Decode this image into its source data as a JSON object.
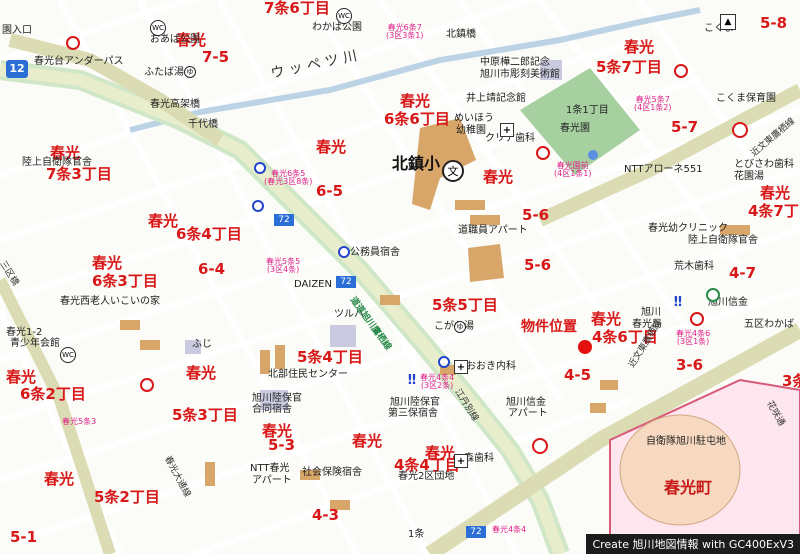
{
  "map": {
    "credit": "Create 旭川地図情報 with GC400ExV3",
    "property_label": "物件位置",
    "red_labels": [
      {
        "text": "7条6丁目"
      },
      {
        "text": "春光"
      },
      {
        "text": "7-5"
      },
      {
        "text": "春光"
      },
      {
        "text": "5条7丁目"
      },
      {
        "text": "5-8"
      },
      {
        "text": "春光"
      },
      {
        "text": "6条6丁目"
      },
      {
        "text": "5-7"
      },
      {
        "text": "春光"
      },
      {
        "text": "7条3丁目"
      },
      {
        "text": "春光"
      },
      {
        "text": "春光"
      },
      {
        "text": "6-5"
      },
      {
        "text": "春光"
      },
      {
        "text": "4条7丁目"
      },
      {
        "text": "5-6"
      },
      {
        "text": "春光"
      },
      {
        "text": "6条4丁目"
      },
      {
        "text": "5-6"
      },
      {
        "text": "春光"
      },
      {
        "text": "6条3丁目"
      },
      {
        "text": "6-4"
      },
      {
        "text": "4-7"
      },
      {
        "text": "5条5丁目"
      },
      {
        "text": "春光"
      },
      {
        "text": "4条6丁目"
      },
      {
        "text": "5条4丁目"
      },
      {
        "text": "春光"
      },
      {
        "text": "6条2丁目"
      },
      {
        "text": "春光"
      },
      {
        "text": "4-5"
      },
      {
        "text": "3-6"
      },
      {
        "text": "3条"
      },
      {
        "text": "5条3丁目"
      },
      {
        "text": "春光"
      },
      {
        "text": "5-3"
      },
      {
        "text": "春光"
      },
      {
        "text": "4条4丁目"
      },
      {
        "text": "春光"
      },
      {
        "text": "5条2丁目"
      },
      {
        "text": "4-3"
      },
      {
        "text": "5-1"
      },
      {
        "text": "春光"
      }
    ],
    "black_labels": [
      {
        "text": "園入口"
      },
      {
        "text": "おあば公園"
      },
      {
        "text": "わかば公園"
      },
      {
        "text": "北鎮橋"
      },
      {
        "text": "こくま"
      },
      {
        "text": "春光台アンダーパス"
      },
      {
        "text": "ふたば湯"
      },
      {
        "text": "中原樺二郎記念"
      },
      {
        "text": "旭川市彫刻美術館"
      },
      {
        "text": "春光高架橋"
      },
      {
        "text": "井上靖記念館"
      },
      {
        "text": "こくま保育園"
      },
      {
        "text": "千代橋"
      },
      {
        "text": "めいほう"
      },
      {
        "text": "幼稚園"
      },
      {
        "text": "1条1丁目"
      },
      {
        "text": "春光園"
      },
      {
        "text": "クリア歯科"
      },
      {
        "text": "陸上自衛隊官舎"
      },
      {
        "text": "NTTアローネ551"
      },
      {
        "text": "花園湯"
      },
      {
        "text": "とびさわ歯科"
      },
      {
        "text": "春光幼クリニック"
      },
      {
        "text": "道職員アパート"
      },
      {
        "text": "陸上自衛隊官舎"
      },
      {
        "text": "公務員宿舎"
      },
      {
        "text": "荒木歯科"
      },
      {
        "text": "春光西老人いこいの家"
      },
      {
        "text": "DAIZEN"
      },
      {
        "text": "旭川信金"
      },
      {
        "text": "五区わかば"
      },
      {
        "text": "こがね湯"
      },
      {
        "text": "旭川"
      },
      {
        "text": "春光局"
      },
      {
        "text": "ツルハ"
      },
      {
        "text": "春光1-2"
      },
      {
        "text": "青少年会館"
      },
      {
        "text": "ふじ"
      },
      {
        "text": "おおき内科"
      },
      {
        "text": "北部住民センター"
      },
      {
        "text": "旭川信金"
      },
      {
        "text": "アパート"
      },
      {
        "text": "旭川陸保官"
      },
      {
        "text": "第三保宿舎"
      },
      {
        "text": "旭川陸保官"
      },
      {
        "text": "合同宿舎"
      },
      {
        "text": "自衛隊旭川駐屯地"
      },
      {
        "text": "NTT春光"
      },
      {
        "text": "アパート"
      },
      {
        "text": "社会保険宿舎"
      },
      {
        "text": "森歯科"
      },
      {
        "text": "春光2区団地"
      },
      {
        "text": "1条"
      }
    ],
    "bold_labels": [
      {
        "text": "北鎮小"
      },
      {
        "text": "春光町"
      },
      {
        "text": "ウ ッ ペ ツ 川"
      }
    ],
    "road_labels": [
      {
        "text": "道道旭川鷹栖線"
      },
      {
        "text": "江丹別線"
      },
      {
        "text": "近文東鷹栖線"
      },
      {
        "text": "春光大通線"
      },
      {
        "text": "近文東鷹栖線"
      },
      {
        "text": "花咲通"
      },
      {
        "text": "三区橋"
      }
    ],
    "route_shields": [
      {
        "text": "12"
      },
      {
        "text": "72"
      },
      {
        "text": "72"
      },
      {
        "text": "72"
      }
    ],
    "bus_stops": [
      {
        "text": "春光6条7\n(3区3条1)"
      },
      {
        "text": "春光5条7\n(4区1条2)"
      },
      {
        "text": "春光園前\n(4区1条1)"
      },
      {
        "text": "春光6条5\n(春光3区8条)"
      },
      {
        "text": "春光5条5\n(3区4条)"
      },
      {
        "text": "春光4条6\n(3区1条)"
      },
      {
        "text": "春光4条4\n(3区2条)"
      },
      {
        "text": "春光5条3"
      },
      {
        "text": "春光4条4"
      }
    ],
    "colors": {
      "background": "#fbfbf7",
      "road_major": "#dcdcb4",
      "road_main": "#cfe7c6",
      "block": "#d9a66a",
      "river": "#bcd3e6",
      "red": "#d81818",
      "magenta": "#e0208a",
      "camp": "#fde6ee"
    }
  }
}
